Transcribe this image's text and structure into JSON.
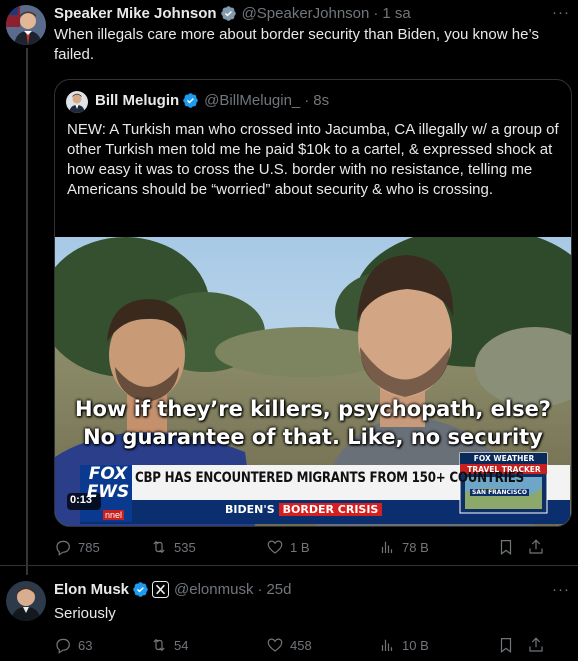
{
  "main_tweet": {
    "author_name": "Speaker Mike Johnson",
    "author_handle": "@SpeakerJohnson",
    "time": "1 sa",
    "text": "When illegals care more about border security than Biden, you know he’s failed.",
    "more": "···",
    "icons": {
      "verified": "verified-badge-icon",
      "more": "more-icon"
    }
  },
  "quoted_tweet": {
    "author_name": "Bill Melugin",
    "author_handle": "@BillMelugin_",
    "time": "8s",
    "text": "NEW: A Turkish man who crossed into Jacumba, CA illegally w/ a group of other Turkish men told me he paid $10k to a cartel, & expressed shock at how easy it was to cross the U.S. border with no resistance, telling me Americans should be “worried” about security & who is crossing.",
    "video": {
      "caption_line1": "How if they’re killers, psychopath, else?",
      "caption_line2": "No guarantee of that. Like, no security",
      "lower_third_headline": "CBP HAS ENCOUNTERED MIGRANTS FROM 150+ COUNTRIES",
      "lower_third_sub_prefix": "BIDEN'S",
      "lower_third_sub_highlight": "BORDER CRISIS",
      "network_logo_top": "FOX",
      "network_logo_bottom": "EWS",
      "channel_fragment": "nnel",
      "duration": "0:13",
      "weather_brand": "FOX WEATHER",
      "weather_title": "TRAVEL TRACKER",
      "map_label": "SAN FRANCISCO"
    }
  },
  "main_actions": {
    "replies": "785",
    "reposts": "535",
    "likes": "1 B",
    "views": "78 B"
  },
  "reply_tweet": {
    "author_name": "Elon Musk",
    "author_handle": "@elonmusk",
    "time": "25d",
    "text": "Seriously",
    "more": "···"
  },
  "reply_actions": {
    "replies": "63",
    "reposts": "54",
    "likes": "458",
    "views": "10 B"
  },
  "colors": {
    "background": "#000000",
    "text": "#e7e9ea",
    "muted": "#71767b",
    "verified": "#1d9bf0",
    "border": "#2f3336",
    "fox_red": "#d6201f",
    "fox_blue": "#0a3a8f"
  }
}
